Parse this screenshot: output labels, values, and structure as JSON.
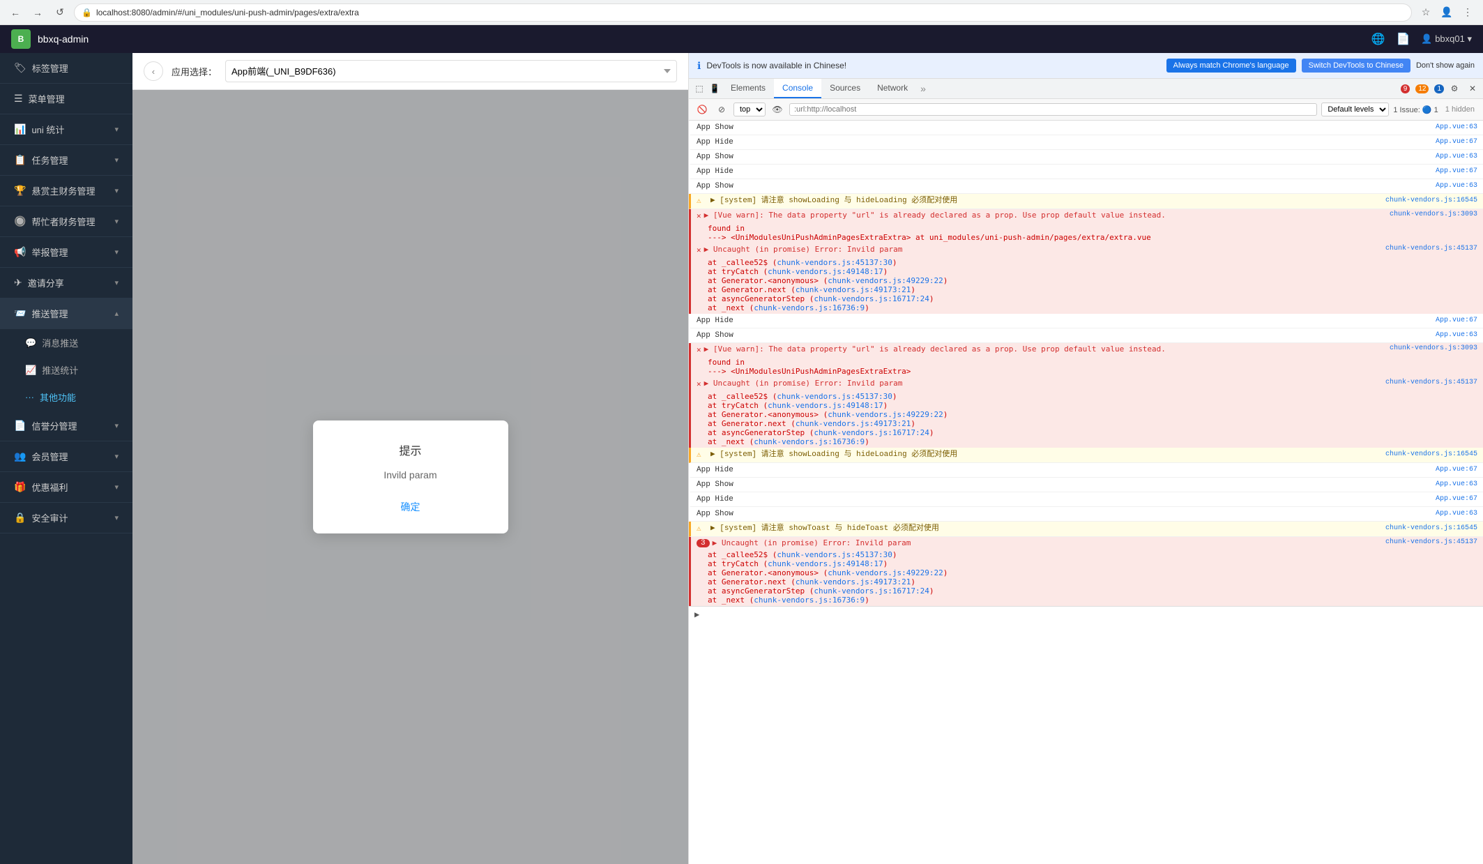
{
  "browser": {
    "url": "localhost:8080/admin/#/uni_modules/uni-push-admin/pages/extra/extra",
    "back_btn": "←",
    "forward_btn": "→",
    "reload_btn": "↺"
  },
  "app": {
    "title": "bbxq-admin",
    "logo": "B"
  },
  "sidebar": {
    "items": [
      {
        "id": "tag",
        "icon": "🏷",
        "label": "标签管理",
        "has_sub": false,
        "expanded": false
      },
      {
        "id": "menu",
        "icon": "☰",
        "label": "菜单管理",
        "has_sub": false,
        "expanded": false
      },
      {
        "id": "uni-stats",
        "icon": "📊",
        "label": "uni 统计",
        "has_sub": true,
        "expanded": false
      },
      {
        "id": "task",
        "icon": "📋",
        "label": "任务管理",
        "has_sub": true,
        "expanded": false
      },
      {
        "id": "reward",
        "icon": "🏆",
        "label": "悬赏主财务管理",
        "has_sub": true,
        "expanded": false
      },
      {
        "id": "helper",
        "icon": "🔘",
        "label": "帮忙者财务管理",
        "has_sub": true,
        "expanded": false
      },
      {
        "id": "report",
        "icon": "📢",
        "label": "举报管理",
        "has_sub": true,
        "expanded": false
      },
      {
        "id": "invite",
        "icon": "➕",
        "label": "邀请分享",
        "has_sub": true,
        "expanded": false
      },
      {
        "id": "push",
        "icon": "📨",
        "label": "推送管理",
        "has_sub": true,
        "expanded": true,
        "active": true
      },
      {
        "id": "msg-push",
        "icon": "💬",
        "label": "消息推送",
        "is_sub": true,
        "active": false
      },
      {
        "id": "push-stats",
        "icon": "📈",
        "label": "推送统计",
        "is_sub": true,
        "active": false
      },
      {
        "id": "other-func",
        "icon": "···",
        "label": "其他功能",
        "is_sub": true,
        "active": true,
        "highlighted": true
      },
      {
        "id": "credit",
        "icon": "📄",
        "label": "信誉分管理",
        "has_sub": true,
        "expanded": false
      },
      {
        "id": "member",
        "icon": "👥",
        "label": "会员管理",
        "has_sub": true,
        "expanded": false
      },
      {
        "id": "welfare",
        "icon": "🎁",
        "label": "优惠福利",
        "has_sub": true,
        "expanded": false
      },
      {
        "id": "security",
        "icon": "🔒",
        "label": "安全审计",
        "has_sub": true,
        "expanded": false
      }
    ]
  },
  "toolbar": {
    "label": "应用选择：",
    "app_value": "App前端(_UNI_B9DF636)",
    "placeholder": "App前端(_UNI_B9DF636)"
  },
  "dialog": {
    "title": "提示",
    "content": "Invild param",
    "confirm_btn": "确定"
  },
  "devtools": {
    "notification": {
      "icon": "ℹ",
      "text": "DevTools is now available in Chinese!",
      "btn1": "Always match Chrome's language",
      "btn2": "Switch DevTools to Chinese",
      "btn3": "Don't show again"
    },
    "tabs": [
      {
        "id": "elements",
        "label": "Elements",
        "active": false
      },
      {
        "id": "console",
        "label": "Console",
        "active": true
      },
      {
        "id": "sources",
        "label": "Sources",
        "active": false
      },
      {
        "id": "network",
        "label": "Network",
        "active": false
      }
    ],
    "badges": {
      "errors": "9",
      "warnings": "12",
      "info": "1"
    },
    "toolbar": {
      "top_label": "top",
      "filter_placeholder": ":url:http://localhost",
      "levels_label": "Default levels",
      "issues_label": "1 Issue: 🔵 1",
      "hidden_label": "1 hidden"
    },
    "console_entries": [
      {
        "type": "info",
        "text": "App Show",
        "link": "App.vue:63"
      },
      {
        "type": "info",
        "text": "App Hide",
        "link": "App.vue:67"
      },
      {
        "type": "info",
        "text": "App Show",
        "link": "App.vue:63"
      },
      {
        "type": "info",
        "text": "App Hide",
        "link": "App.vue:67"
      },
      {
        "type": "info",
        "text": "App Show",
        "link": "App.vue:63"
      },
      {
        "type": "warn",
        "text": "▶ [system] 请注意 showLoading 与 hideLoading 必须配对使用",
        "link": "chunk-vendors.js:16545"
      },
      {
        "type": "error",
        "text": "▶ [Vue warn]: The data property \"url\" is already declared as a prop. Use prop default value instead.",
        "link": "chunk-vendors.js:3093",
        "sub": [
          "found in",
          "---> <UniModulesUniPushAdminPagesExtraExtra> at uni_modules/uni-push-admin/pages/extra/extra.vue"
        ]
      },
      {
        "type": "error",
        "text": "▶ Uncaught (in promise) Error: Invild param",
        "link": "chunk-vendors.js:45137",
        "sub": [
          "at _callee52$ (chunk-vendors.js:45137:30)",
          "at tryCatch (chunk-vendors.js:49148:17)",
          "at Generator.<anonymous> (chunk-vendors.js:49229:22)",
          "at Generator.next (chunk-vendors.js:49173:21)",
          "at asyncGeneratorStep (chunk-vendors.js:16717:24)",
          "at _next (chunk-vendors.js:16736:9)"
        ]
      },
      {
        "type": "info",
        "text": "App Hide",
        "link": "App.vue:67"
      },
      {
        "type": "info",
        "text": "App Show",
        "link": "App.vue:63"
      },
      {
        "type": "error",
        "text": "▶ [Vue warn]: The data property \"url\" is already declared as a prop. Use prop default value instead.",
        "link": "chunk-vendors.js:3093",
        "sub": [
          "found in",
          "---> <UniModulesUniPushAdminPagesExtraExtra>"
        ]
      },
      {
        "type": "error",
        "text": "▶ Uncaught (in promise) Error: Invild param",
        "link": "chunk-vendors.js:45137",
        "sub": [
          "at _callee52$ (chunk-vendors.js:45137:30)",
          "at tryCatch (chunk-vendors.js:49148:17)",
          "at Generator.<anonymous> (chunk-vendors.js:49229:22)",
          "at Generator.next (chunk-vendors.js:49173:21)",
          "at asyncGeneratorStep (chunk-vendors.js:16717:24)",
          "at _next (chunk-vendors.js:16736:9)"
        ]
      },
      {
        "type": "warn",
        "text": "▶ [system] 请注意 showLoading 与 hideLoading 必须配对使用",
        "link": "chunk-vendors.js:16545"
      },
      {
        "type": "info",
        "text": "App Hide",
        "link": "App.vue:67"
      },
      {
        "type": "info",
        "text": "App Show",
        "link": "App.vue:63"
      },
      {
        "type": "info",
        "text": "App Hide",
        "link": "App.vue:67"
      },
      {
        "type": "info",
        "text": "App Show",
        "link": "App.vue:63"
      },
      {
        "type": "warn",
        "text": "▶ [system] 请注意 showToast 与 hideToast 必须配对使用",
        "link": "chunk-vendors.js:16545"
      },
      {
        "type": "error",
        "count": 3,
        "text": "▶ Uncaught (in promise) Error: Invild param",
        "link": "chunk-vendors.js:45137",
        "sub": [
          "at _callee52$ (chunk-vendors.js:45137:30)",
          "at tryCatch (chunk-vendors.js:49148:17)",
          "at Generator.<anonymous> (chunk-vendors.js:49229:22)",
          "at Generator.next (chunk-vendors.js:49173:21)",
          "at asyncGeneratorStep (chunk-vendors.js:16717:24)",
          "at _next (chunk-vendors.js:16736:9)"
        ]
      }
    ]
  }
}
